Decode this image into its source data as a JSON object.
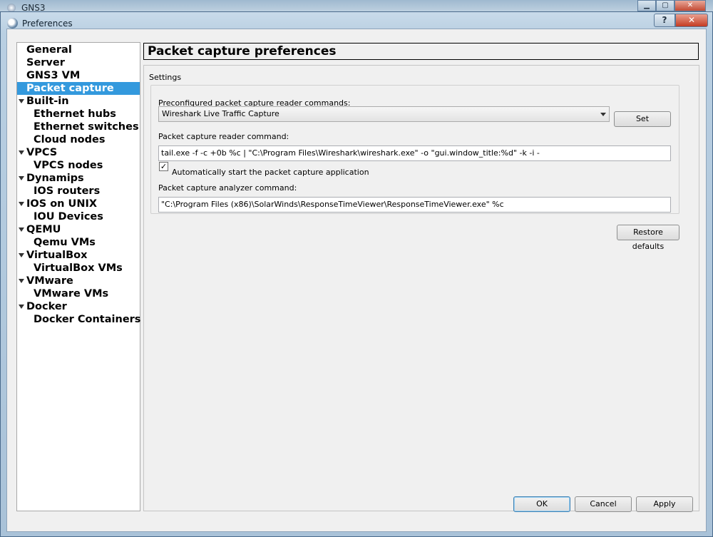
{
  "background_window": {
    "title": "GNS3"
  },
  "dialog": {
    "title": "Preferences",
    "help_label": "?",
    "close_label": "✕"
  },
  "nav": {
    "items": [
      {
        "label": "General",
        "level": 0,
        "expandable": false,
        "selected": false
      },
      {
        "label": "Server",
        "level": 0,
        "expandable": false,
        "selected": false
      },
      {
        "label": "GNS3 VM",
        "level": 0,
        "expandable": false,
        "selected": false
      },
      {
        "label": "Packet capture",
        "level": 0,
        "expandable": false,
        "selected": true
      },
      {
        "label": "Built-in",
        "level": 0,
        "expandable": true,
        "selected": false
      },
      {
        "label": "Ethernet hubs",
        "level": 1,
        "expandable": false,
        "selected": false
      },
      {
        "label": "Ethernet switches",
        "level": 1,
        "expandable": false,
        "selected": false
      },
      {
        "label": "Cloud nodes",
        "level": 1,
        "expandable": false,
        "selected": false
      },
      {
        "label": "VPCS",
        "level": 0,
        "expandable": true,
        "selected": false
      },
      {
        "label": "VPCS nodes",
        "level": 1,
        "expandable": false,
        "selected": false
      },
      {
        "label": "Dynamips",
        "level": 0,
        "expandable": true,
        "selected": false
      },
      {
        "label": "IOS routers",
        "level": 1,
        "expandable": false,
        "selected": false
      },
      {
        "label": "IOS on UNIX",
        "level": 0,
        "expandable": true,
        "selected": false
      },
      {
        "label": "IOU Devices",
        "level": 1,
        "expandable": false,
        "selected": false
      },
      {
        "label": "QEMU",
        "level": 0,
        "expandable": true,
        "selected": false
      },
      {
        "label": "Qemu VMs",
        "level": 1,
        "expandable": false,
        "selected": false
      },
      {
        "label": "VirtualBox",
        "level": 0,
        "expandable": true,
        "selected": false
      },
      {
        "label": "VirtualBox VMs",
        "level": 1,
        "expandable": false,
        "selected": false
      },
      {
        "label": "VMware",
        "level": 0,
        "expandable": true,
        "selected": false
      },
      {
        "label": "VMware VMs",
        "level": 1,
        "expandable": false,
        "selected": false
      },
      {
        "label": "Docker",
        "level": 0,
        "expandable": true,
        "selected": false
      },
      {
        "label": "Docker Containers",
        "level": 1,
        "expandable": false,
        "selected": false
      }
    ]
  },
  "page": {
    "title": "Packet capture preferences",
    "group_title": "Settings",
    "preconfigured_label": "Preconfigured packet capture reader commands:",
    "preconfigured_value": "Wireshark Live Traffic Capture",
    "set_button": "Set",
    "reader_label": "Packet capture reader command:",
    "reader_value": "tail.exe -f -c +0b %c | \"C:\\Program Files\\Wireshark\\wireshark.exe\" -o \"gui.window_title:%d\" -k -i -",
    "auto_start_checked": true,
    "auto_start_label": "Automatically start the packet capture application",
    "analyzer_label": "Packet capture analyzer command:",
    "analyzer_value": "\"C:\\Program Files (x86)\\SolarWinds\\ResponseTimeViewer\\ResponseTimeViewer.exe\" %c",
    "restore_button": "Restore defaults"
  },
  "footer": {
    "ok_button": "OK",
    "cancel_button": "Cancel",
    "apply_button": "Apply"
  },
  "colors": {
    "selection": "#3399dd",
    "dialog_background": "#f0f0f0"
  }
}
